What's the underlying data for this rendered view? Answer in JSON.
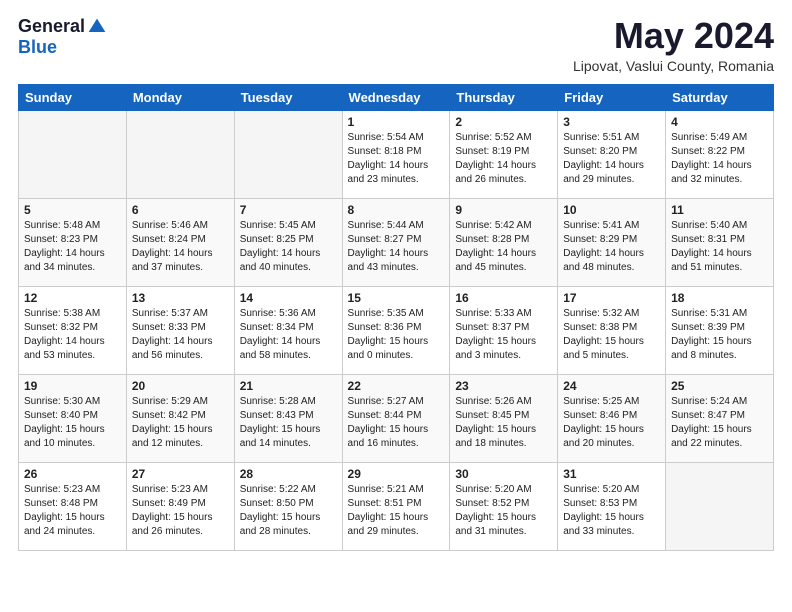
{
  "logo": {
    "general": "General",
    "blue": "Blue"
  },
  "title": "May 2024",
  "subtitle": "Lipovat, Vaslui County, Romania",
  "headers": [
    "Sunday",
    "Monday",
    "Tuesday",
    "Wednesday",
    "Thursday",
    "Friday",
    "Saturday"
  ],
  "weeks": [
    [
      {
        "day": "",
        "info": ""
      },
      {
        "day": "",
        "info": ""
      },
      {
        "day": "",
        "info": ""
      },
      {
        "day": "1",
        "info": "Sunrise: 5:54 AM\nSunset: 8:18 PM\nDaylight: 14 hours\nand 23 minutes."
      },
      {
        "day": "2",
        "info": "Sunrise: 5:52 AM\nSunset: 8:19 PM\nDaylight: 14 hours\nand 26 minutes."
      },
      {
        "day": "3",
        "info": "Sunrise: 5:51 AM\nSunset: 8:20 PM\nDaylight: 14 hours\nand 29 minutes."
      },
      {
        "day": "4",
        "info": "Sunrise: 5:49 AM\nSunset: 8:22 PM\nDaylight: 14 hours\nand 32 minutes."
      }
    ],
    [
      {
        "day": "5",
        "info": "Sunrise: 5:48 AM\nSunset: 8:23 PM\nDaylight: 14 hours\nand 34 minutes."
      },
      {
        "day": "6",
        "info": "Sunrise: 5:46 AM\nSunset: 8:24 PM\nDaylight: 14 hours\nand 37 minutes."
      },
      {
        "day": "7",
        "info": "Sunrise: 5:45 AM\nSunset: 8:25 PM\nDaylight: 14 hours\nand 40 minutes."
      },
      {
        "day": "8",
        "info": "Sunrise: 5:44 AM\nSunset: 8:27 PM\nDaylight: 14 hours\nand 43 minutes."
      },
      {
        "day": "9",
        "info": "Sunrise: 5:42 AM\nSunset: 8:28 PM\nDaylight: 14 hours\nand 45 minutes."
      },
      {
        "day": "10",
        "info": "Sunrise: 5:41 AM\nSunset: 8:29 PM\nDaylight: 14 hours\nand 48 minutes."
      },
      {
        "day": "11",
        "info": "Sunrise: 5:40 AM\nSunset: 8:31 PM\nDaylight: 14 hours\nand 51 minutes."
      }
    ],
    [
      {
        "day": "12",
        "info": "Sunrise: 5:38 AM\nSunset: 8:32 PM\nDaylight: 14 hours\nand 53 minutes."
      },
      {
        "day": "13",
        "info": "Sunrise: 5:37 AM\nSunset: 8:33 PM\nDaylight: 14 hours\nand 56 minutes."
      },
      {
        "day": "14",
        "info": "Sunrise: 5:36 AM\nSunset: 8:34 PM\nDaylight: 14 hours\nand 58 minutes."
      },
      {
        "day": "15",
        "info": "Sunrise: 5:35 AM\nSunset: 8:36 PM\nDaylight: 15 hours\nand 0 minutes."
      },
      {
        "day": "16",
        "info": "Sunrise: 5:33 AM\nSunset: 8:37 PM\nDaylight: 15 hours\nand 3 minutes."
      },
      {
        "day": "17",
        "info": "Sunrise: 5:32 AM\nSunset: 8:38 PM\nDaylight: 15 hours\nand 5 minutes."
      },
      {
        "day": "18",
        "info": "Sunrise: 5:31 AM\nSunset: 8:39 PM\nDaylight: 15 hours\nand 8 minutes."
      }
    ],
    [
      {
        "day": "19",
        "info": "Sunrise: 5:30 AM\nSunset: 8:40 PM\nDaylight: 15 hours\nand 10 minutes."
      },
      {
        "day": "20",
        "info": "Sunrise: 5:29 AM\nSunset: 8:42 PM\nDaylight: 15 hours\nand 12 minutes."
      },
      {
        "day": "21",
        "info": "Sunrise: 5:28 AM\nSunset: 8:43 PM\nDaylight: 15 hours\nand 14 minutes."
      },
      {
        "day": "22",
        "info": "Sunrise: 5:27 AM\nSunset: 8:44 PM\nDaylight: 15 hours\nand 16 minutes."
      },
      {
        "day": "23",
        "info": "Sunrise: 5:26 AM\nSunset: 8:45 PM\nDaylight: 15 hours\nand 18 minutes."
      },
      {
        "day": "24",
        "info": "Sunrise: 5:25 AM\nSunset: 8:46 PM\nDaylight: 15 hours\nand 20 minutes."
      },
      {
        "day": "25",
        "info": "Sunrise: 5:24 AM\nSunset: 8:47 PM\nDaylight: 15 hours\nand 22 minutes."
      }
    ],
    [
      {
        "day": "26",
        "info": "Sunrise: 5:23 AM\nSunset: 8:48 PM\nDaylight: 15 hours\nand 24 minutes."
      },
      {
        "day": "27",
        "info": "Sunrise: 5:23 AM\nSunset: 8:49 PM\nDaylight: 15 hours\nand 26 minutes."
      },
      {
        "day": "28",
        "info": "Sunrise: 5:22 AM\nSunset: 8:50 PM\nDaylight: 15 hours\nand 28 minutes."
      },
      {
        "day": "29",
        "info": "Sunrise: 5:21 AM\nSunset: 8:51 PM\nDaylight: 15 hours\nand 29 minutes."
      },
      {
        "day": "30",
        "info": "Sunrise: 5:20 AM\nSunset: 8:52 PM\nDaylight: 15 hours\nand 31 minutes."
      },
      {
        "day": "31",
        "info": "Sunrise: 5:20 AM\nSunset: 8:53 PM\nDaylight: 15 hours\nand 33 minutes."
      },
      {
        "day": "",
        "info": ""
      }
    ]
  ]
}
